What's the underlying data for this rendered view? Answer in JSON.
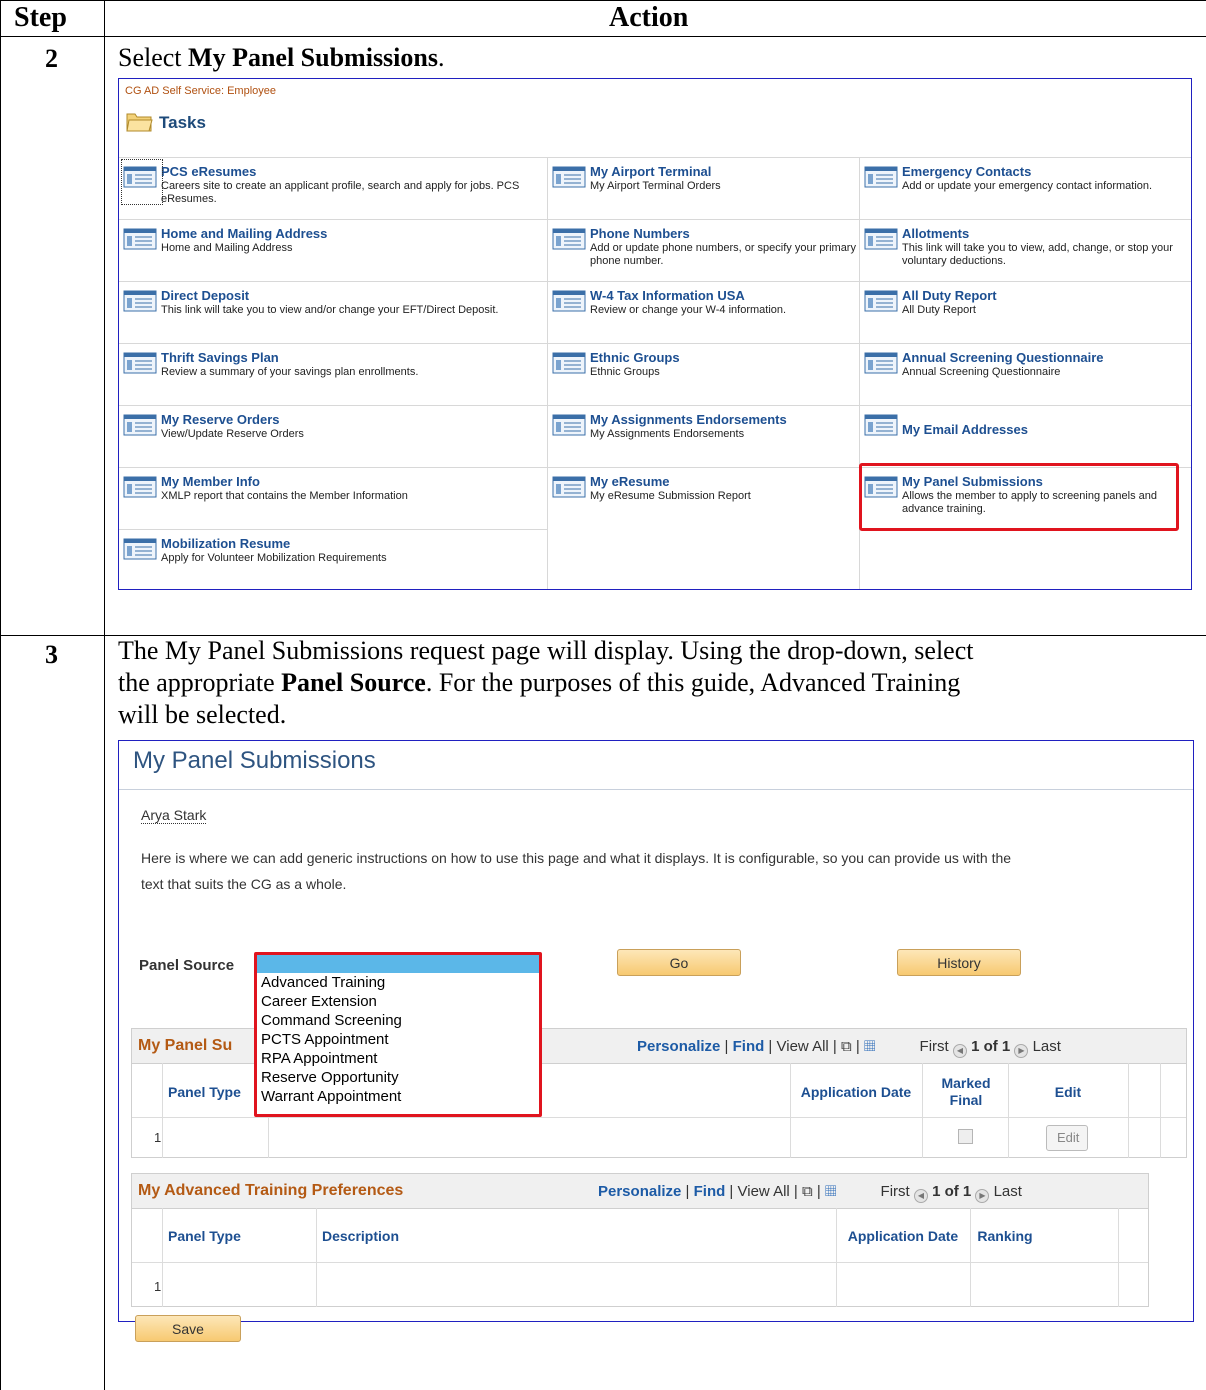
{
  "table_headers": {
    "step": "Step",
    "action": "Action"
  },
  "step2": {
    "number": "2",
    "instruction_prefix": "Select ",
    "instruction_bold": "My Panel Submissions",
    "instruction_suffix": ".",
    "screenshot": {
      "brand": "CG AD Self Service: Employee",
      "title": "Tasks",
      "tasks": [
        {
          "title": "PCS eResumes",
          "desc": "Careers site to create an applicant profile, search and apply for jobs. PCS eResumes."
        },
        {
          "title": "My Airport Terminal",
          "desc": "My Airport Terminal Orders"
        },
        {
          "title": "Emergency Contacts",
          "desc": "Add or update your emergency contact information."
        },
        {
          "title": "Home and Mailing Address",
          "desc": "Home and Mailing Address"
        },
        {
          "title": "Phone Numbers",
          "desc": "Add or update phone numbers, or specify your primary phone number."
        },
        {
          "title": "Allotments",
          "desc": "This link will take you to view, add, change, or stop your voluntary deductions."
        },
        {
          "title": "Direct Deposit",
          "desc": "This link will take you to view and/or change your EFT/Direct Deposit."
        },
        {
          "title": "W-4 Tax Information USA",
          "desc": "Review or change your W-4 information."
        },
        {
          "title": "All Duty Report",
          "desc": "All Duty Report"
        },
        {
          "title": "Thrift Savings Plan",
          "desc": "Review a summary of your savings plan enrollments."
        },
        {
          "title": "Ethnic Groups",
          "desc": "Ethnic Groups"
        },
        {
          "title": "Annual Screening Questionnaire",
          "desc": "Annual Screening Questionnaire"
        },
        {
          "title": "My Reserve Orders",
          "desc": "View/Update Reserve Orders"
        },
        {
          "title": "My Assignments Endorsements",
          "desc": "My Assignments Endorsements"
        },
        {
          "title": "My Email Addresses",
          "desc": ""
        },
        {
          "title": "My Member Info",
          "desc": "XMLP report that contains the Member Information"
        },
        {
          "title": "My eResume",
          "desc": "My eResume Submission Report"
        },
        {
          "title": "My Panel Submissions",
          "desc": "Allows the member to apply to screening panels and advance training."
        },
        {
          "title": "Mobilization Resume",
          "desc": "Apply for Volunteer Mobilization Requirements"
        }
      ]
    }
  },
  "step3": {
    "number": "3",
    "line1": "The My Panel Submissions request page will display.  Using the drop-down, select",
    "line2_prefix": "the appropriate ",
    "line2_bold": "Panel Source",
    "line2_suffix": ".  For the purposes of this guide, Advanced Training",
    "line3": "will be selected.",
    "screenshot": {
      "title": "My Panel Submissions",
      "user_name": "Arya Stark",
      "instructions": "Here is where we can add generic instructions on how to use this page and what it displays. It is configurable, so you can provide us with the text that suits the CG as a whole.",
      "panel_source_label": "Panel Source",
      "panel_source_options": [
        "Advanced Training",
        "Career Extension",
        "Command Screening",
        "PCTS Appointment",
        "RPA Appointment",
        "Reserve Opportunity",
        "Warrant Appointment"
      ],
      "go_label": "Go",
      "history_label": "History",
      "grid1": {
        "title_visible": "My Panel Su",
        "personalize": "Personalize",
        "find": "Find",
        "view_all": "View All",
        "first": "First",
        "pager": "1 of 1",
        "last": "Last",
        "columns": [
          "Panel Type",
          "Application Date",
          "Marked Final",
          "Edit"
        ],
        "row_number": "1",
        "edit_button": "Edit"
      },
      "grid2": {
        "title": "My Advanced Training Preferences",
        "personalize": "Personalize",
        "find": "Find",
        "view_all": "View All",
        "first": "First",
        "pager": "1 of 1",
        "last": "Last",
        "columns": [
          "Panel Type",
          "Description",
          "Application Date",
          "Ranking"
        ],
        "row_number": "1"
      },
      "save_label": "Save"
    }
  },
  "colors": {
    "highlight": "#e0141e",
    "link": "#1d4f91",
    "grid_title": "#b45a14"
  }
}
